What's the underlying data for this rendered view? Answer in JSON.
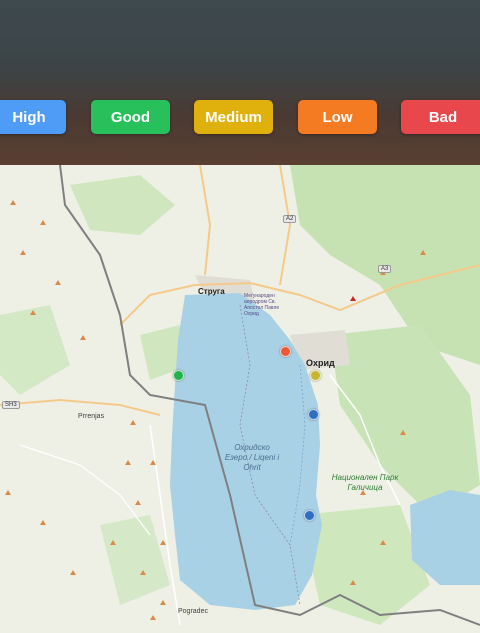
{
  "filters": [
    {
      "label": "High",
      "color": "#4f9cf7"
    },
    {
      "label": "Good",
      "color": "#28c05a"
    },
    {
      "label": "Medium",
      "color": "#e0b10d"
    },
    {
      "label": "Low",
      "color": "#f47b21"
    },
    {
      "label": "Bad",
      "color": "#e8474b"
    }
  ],
  "map": {
    "lake_label": "Охридско Езеро / Liqeni i Ohrit",
    "park_label": "Национален Парк Галичица",
    "places": {
      "struga": "Струга",
      "ohrid": "Охрид",
      "pogradec": "Pogradec",
      "prrenjas": "Prrenjas",
      "airport": "Меѓународен аеродром Св. Апостол Павле Охрид"
    },
    "roads": {
      "a2": "A2",
      "a3": "A3",
      "sh3": "SH3"
    },
    "markers": [
      {
        "name": "marker-green",
        "color": "#22b24c"
      },
      {
        "name": "marker-red",
        "color": "#e85a3a"
      },
      {
        "name": "marker-yellow",
        "color": "#c8b530"
      },
      {
        "name": "marker-blue-1",
        "color": "#2f6fc2"
      },
      {
        "name": "marker-blue-2",
        "color": "#2f6fc2"
      }
    ]
  }
}
